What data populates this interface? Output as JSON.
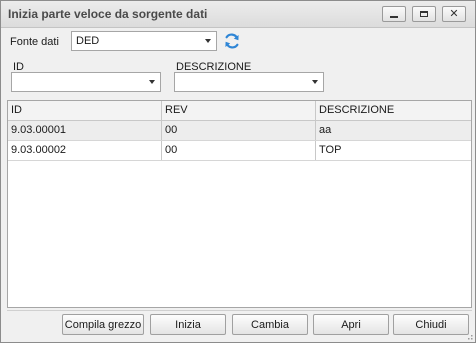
{
  "window": {
    "title": "Inizia parte veloce da sorgente dati"
  },
  "source": {
    "label": "Fonte dati",
    "value": "DED"
  },
  "filters": {
    "id_label": "ID",
    "id_value": "",
    "descr_label": "DESCRIZIONE",
    "descr_value": ""
  },
  "grid": {
    "columns": [
      "ID",
      "REV",
      "DESCRIZIONE"
    ],
    "rows": [
      [
        "9.03.00001",
        "00",
        "aa"
      ],
      [
        "9.03.00002",
        "00",
        "TOP"
      ]
    ]
  },
  "buttons": {
    "compila": "Compila grezzo",
    "inizia": "Inizia",
    "cambia": "Cambia",
    "apri": "Apri",
    "chiudi": "Chiudi"
  },
  "icons": {
    "refresh": "refresh-icon",
    "min": "minimize-icon",
    "max": "maximize-icon",
    "close": "close-icon"
  },
  "colors": {
    "refresh_accent": "#2f86d6"
  }
}
